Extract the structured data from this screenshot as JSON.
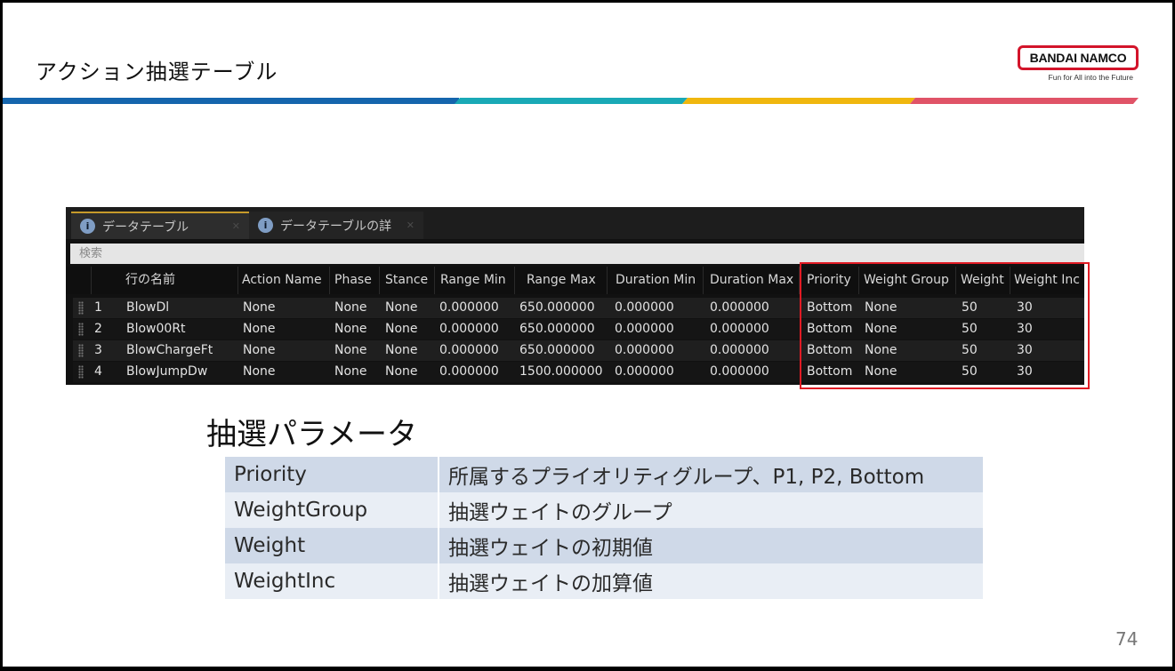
{
  "slide": {
    "title": "アクション抽選テーブル",
    "page_number": "74",
    "logo_text": "BANDAI NAMCO",
    "logo_tagline": "Fun for All into the Future"
  },
  "editor": {
    "tabs": [
      {
        "label": "データテーブル",
        "icon": "info-icon"
      },
      {
        "label": "データテーブルの詳",
        "icon": "info-icon"
      }
    ],
    "search_placeholder": "検索",
    "columns": [
      "行の名前",
      "Action Name",
      "Phase",
      "Stance",
      "Range Min",
      "Range Max",
      "Duration Min",
      "Duration Max",
      "Priority",
      "Weight Group",
      "Weight",
      "Weight Inc"
    ],
    "rows": [
      {
        "index": "1",
        "cells": [
          "BlowDl",
          "None",
          "None",
          "None",
          "0.000000",
          "650.000000",
          "0.000000",
          "0.000000",
          "Bottom",
          "None",
          "50",
          "30"
        ]
      },
      {
        "index": "2",
        "cells": [
          "Blow00Rt",
          "None",
          "None",
          "None",
          "0.000000",
          "650.000000",
          "0.000000",
          "0.000000",
          "Bottom",
          "None",
          "50",
          "30"
        ]
      },
      {
        "index": "3",
        "cells": [
          "BlowChargeFt",
          "None",
          "None",
          "None",
          "0.000000",
          "650.000000",
          "0.000000",
          "0.000000",
          "Bottom",
          "None",
          "50",
          "30"
        ]
      },
      {
        "index": "4",
        "cells": [
          "BlowJumpDw",
          "None",
          "None",
          "None",
          "0.000000",
          "1500.000000",
          "0.000000",
          "0.000000",
          "Bottom",
          "None",
          "50",
          "30"
        ]
      }
    ]
  },
  "params": {
    "title": "抽選パラメータ",
    "rows": [
      {
        "name": "Priority",
        "desc": "所属するプライオリティグループ、P1, P2, Bottom"
      },
      {
        "name": "WeightGroup",
        "desc": "抽選ウェイトのグループ"
      },
      {
        "name": "Weight",
        "desc": "抽選ウェイトの初期値"
      },
      {
        "name": "WeightInc",
        "desc": "抽選ウェイトの加算値"
      }
    ]
  },
  "colors": {
    "brand_red": "#d3142a",
    "stripe_blue": "#1565ad",
    "stripe_teal": "#19a9b6",
    "stripe_yellow": "#f0b70e",
    "stripe_pink": "#e05367",
    "highlight_box": "#e01b24"
  }
}
